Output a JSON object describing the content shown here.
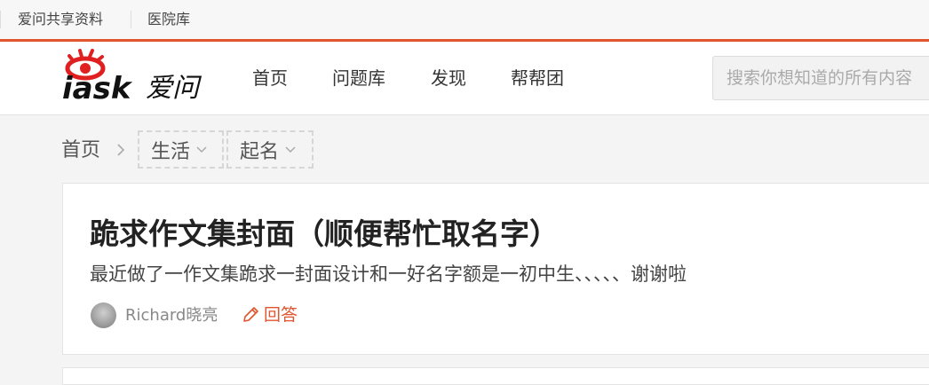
{
  "topbar": {
    "links": [
      "爱问共享资料",
      "医院库"
    ]
  },
  "header": {
    "logo_text": "iask爱问",
    "nav": [
      "首页",
      "问题库",
      "发现",
      "帮帮团"
    ],
    "search_placeholder": "搜索你想知道的所有内容"
  },
  "breadcrumb": {
    "home": "首页",
    "category": "生活",
    "subcategory": "起名"
  },
  "question": {
    "title": "跪求作文集封面（顺便帮忙取名字）",
    "description": "最近做了一作文集跪求一封面设计和一好名字额是一初中生、、、、、谢谢啦",
    "username": "Richard晓亮",
    "answer_label": "回答"
  },
  "colors": {
    "accent": "#e0552d",
    "logo_red": "#e02020"
  }
}
